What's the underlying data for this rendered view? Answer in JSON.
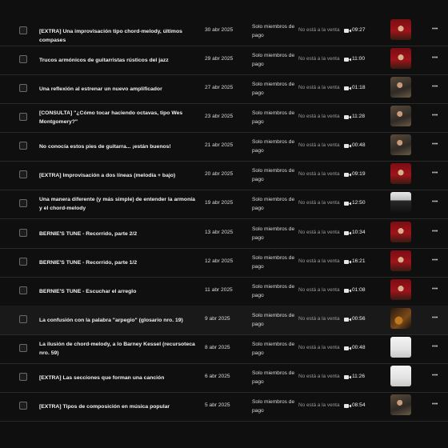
{
  "rows": [
    {
      "title": "[EXTRA] Una improvisación tipo chord-melody, últimos compases",
      "date": "30 abr 2025",
      "access": "Solo miembros de pago",
      "sale": "No está a la venta",
      "duration": "09:27",
      "thumb": "red-stage"
    },
    {
      "title": "Trucos armónicos de guitarristas rústicos del jazz",
      "date": "29 abr 2025",
      "access": "Solo miembros de pago",
      "sale": "No está a la venta",
      "duration": "11:00",
      "thumb": "red-stage"
    },
    {
      "title": "Una reflexión al estrenar un nuevo amplificador",
      "date": "27 abr 2025",
      "access": "Solo miembros de pago",
      "sale": "No está a la venta",
      "duration": "01:18",
      "thumb": "room"
    },
    {
      "title": "[CONSULTA] \"¿Cómo tocar haciendo octavas, tipo Wes Montgomery?\"",
      "date": "23 abr 2025",
      "access": "Solo miembros de pago",
      "sale": "No está a la venta",
      "duration": "11:28",
      "thumb": "room"
    },
    {
      "title": "No conocía estos pies de guitarra... ¡están buenos!",
      "date": "21 abr 2025",
      "access": "Solo miembros de pago",
      "sale": "No está a la venta",
      "duration": "00:48",
      "thumb": "room"
    },
    {
      "title": "[EXTRA] Improvisación a dos líneas (melodía + bajo)",
      "date": "20 abr 2025",
      "access": "Solo miembros de pago",
      "sale": "No está a la venta",
      "duration": "09:19",
      "thumb": "red-stage"
    },
    {
      "title": "Una manera diferente (y más simple) de entender la armonía y el chord-melody",
      "date": "19 abr 2025",
      "access": "Solo miembros de pago",
      "sale": "No está a la venta",
      "duration": "12:50",
      "thumb": "bw"
    },
    {
      "title": "BERNIE'S TUNE - Recorrido, parte 2/2",
      "date": "13 abr 2025",
      "access": "Solo miembros de pago",
      "sale": "No está a la venta",
      "duration": "10:34",
      "thumb": "red-stage"
    },
    {
      "title": "BERNIE'S TUNE - Recorrido, parte 1/2",
      "date": "12 abr 2025",
      "access": "Solo miembros de pago",
      "sale": "No está a la venta",
      "duration": "16:21",
      "thumb": "red-stage"
    },
    {
      "title": "BERNIE'S TUNE - Escuchar el arreglo",
      "date": "11 abr 2025",
      "access": "Solo miembros de pago",
      "sale": "No está a la venta",
      "duration": "01:08",
      "thumb": "red-stage"
    },
    {
      "title": "La confusión con la palabra \"arpegio\" (glosario nro. 19)",
      "date": "9 abr 2025",
      "access": "Solo miembros de pago",
      "sale": "No está a la venta",
      "duration": "00:56",
      "thumb": "guitar"
    },
    {
      "title": "La ilusión de chord-melody, a lo Barney Kessel (recursoteca nro. 59)",
      "date": "8 abr 2025",
      "access": "Solo miembros de pago",
      "sale": "No está a la venta",
      "duration": "00:48",
      "thumb": "white"
    },
    {
      "title": "[EXTRA] Las secciones que forman una canción",
      "date": "6 abr 2025",
      "access": "Solo miembros de pago",
      "sale": "No está a la venta",
      "duration": "11:26",
      "thumb": "white"
    },
    {
      "title": "[EXTRA] Tipos de composición en música popular",
      "date": "5 abr 2025",
      "access": "Solo miembros de pago",
      "sale": "No está a la venta",
      "duration": "08:54",
      "thumb": "room"
    }
  ],
  "colors": {
    "background": "#0f0f0f",
    "row_highlight": "#191919",
    "divider": "#2a2a2a"
  },
  "icons": {
    "checkbox": "checkbox-icon",
    "duration": "video-camera-icon",
    "menu": "more-options-icon"
  },
  "highlighted_row": 10
}
